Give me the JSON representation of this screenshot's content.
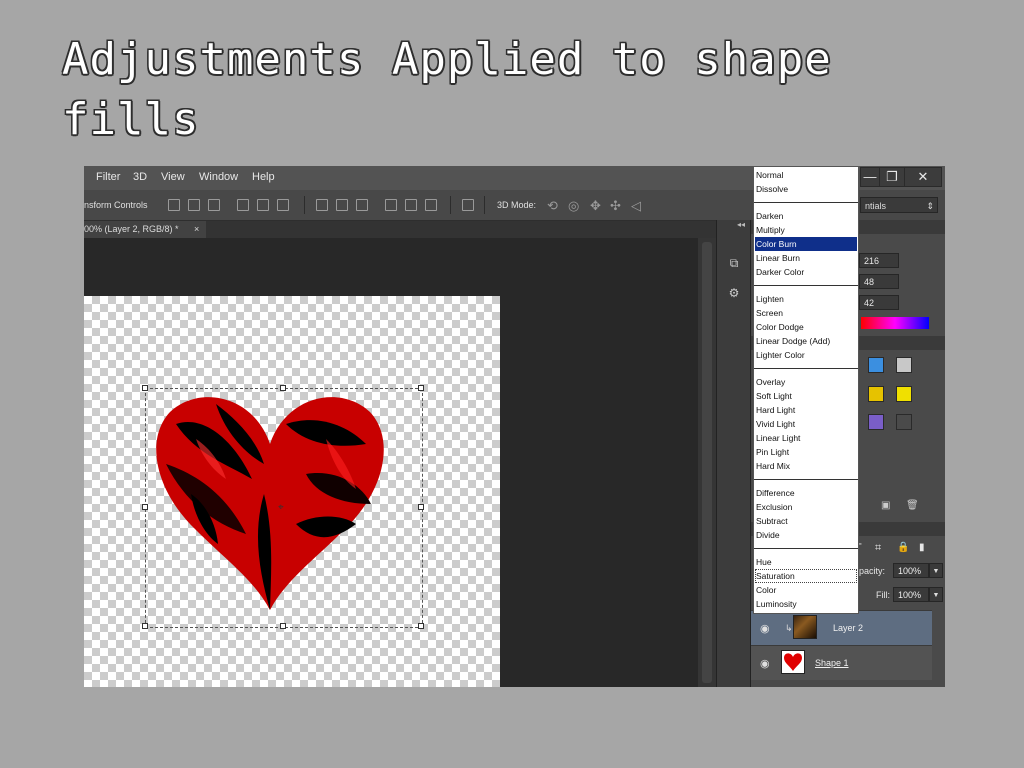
{
  "slide": {
    "title_line1": "Adjustments Applied to shape",
    "title_line2": "fills"
  },
  "menubar": {
    "items": [
      "Filter",
      "3D",
      "View",
      "Window",
      "Help"
    ],
    "window_buttons": {
      "minimize": "—",
      "restore": "❐",
      "close": "✕"
    }
  },
  "options_bar": {
    "transform_controls_label": "nsform Controls",
    "three_d_mode_label": "3D Mode:",
    "workspace_select": "ntials"
  },
  "document": {
    "tab_title": "00% (Layer 2, RGB/8) *",
    "tab_close": "×"
  },
  "color_panel": {
    "r": "216",
    "g": "48",
    "b": "42",
    "swatch_colors": [
      "#3b8fe0",
      "#c8c8c8",
      "#e6c200",
      "#f0e000",
      "#7a5ec8",
      "#4a4a4a"
    ]
  },
  "layers_panel": {
    "opacity_label": "pacity:",
    "opacity_value": "100%",
    "fill_label": "Fill:",
    "fill_value": "100%",
    "tool_icons": [
      "T",
      "⌗",
      "🔒",
      "▮"
    ],
    "layers": [
      {
        "name": "Layer 2",
        "selected": true
      },
      {
        "name": "Shape 1",
        "selected": false
      }
    ]
  },
  "blend_modes": {
    "groups": [
      [
        "Normal",
        "Dissolve"
      ],
      [
        "Darken",
        "Multiply",
        "Color Burn",
        "Linear Burn",
        "Darker Color"
      ],
      [
        "Lighten",
        "Screen",
        "Color Dodge",
        "Linear Dodge (Add)",
        "Lighter Color"
      ],
      [
        "Overlay",
        "Soft Light",
        "Hard Light",
        "Vivid Light",
        "Linear Light",
        "Pin Light",
        "Hard Mix"
      ],
      [
        "Difference",
        "Exclusion",
        "Subtract",
        "Divide"
      ],
      [
        "Hue",
        "Saturation",
        "Color",
        "Luminosity"
      ]
    ],
    "highlighted": "Color Burn",
    "focused": "Saturation"
  },
  "colors": {
    "highlight": "#0f2f8a",
    "heart_red": "#e00000",
    "selected_layer": "#5e6d81"
  }
}
